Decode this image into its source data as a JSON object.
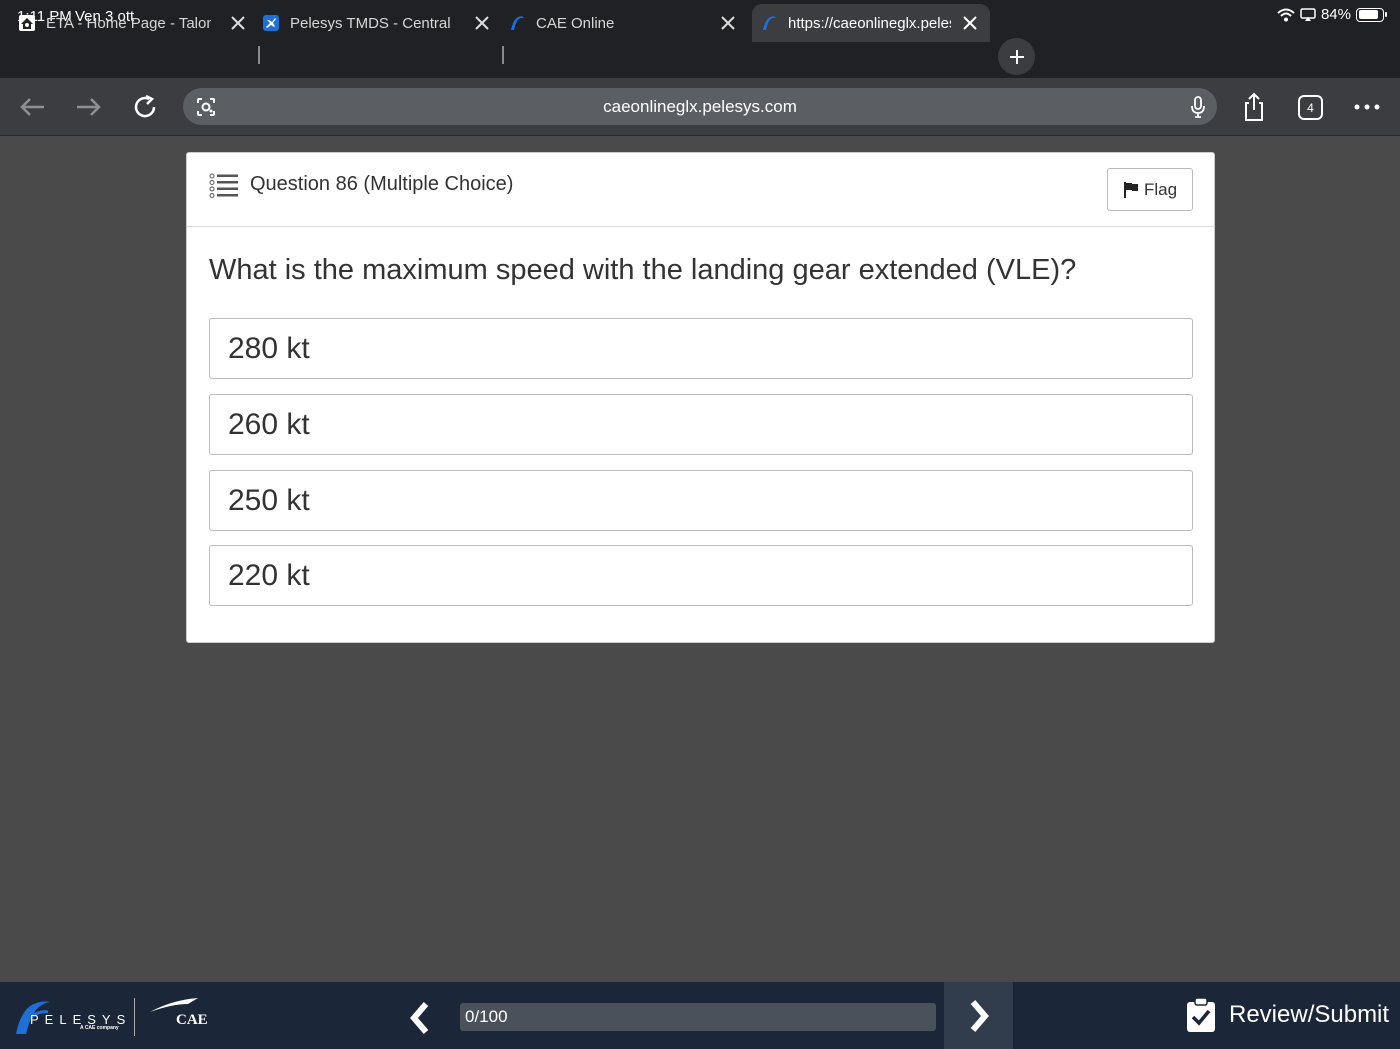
{
  "status_bar": {
    "time": "1:11 PM",
    "date": "Ven 3 ott",
    "battery": "84%",
    "battery_level": 0.84
  },
  "tabs": [
    {
      "title": "ETA - Home Page - Talon",
      "favicon": "home-icon",
      "active": false
    },
    {
      "title": "Pelesys TMDS - Central",
      "favicon": "plane-icon",
      "active": false
    },
    {
      "title": "CAE Online",
      "favicon": "pelesys-icon",
      "active": false
    },
    {
      "title": "https://caeonlineglx.pelesys.com",
      "favicon": "pelesys-icon",
      "active": true
    }
  ],
  "toolbar": {
    "url": "caeonlineglx.pelesys.com",
    "tab_count": "4"
  },
  "question": {
    "header": "Question 86 (Multiple Choice)",
    "flag_label": "Flag",
    "text": "What is the maximum speed with the landing gear extended (VLE)?",
    "answers": [
      "280 kt",
      "260 kt",
      "250 kt",
      "220 kt"
    ]
  },
  "footer": {
    "brand": "PELESYS",
    "brand_sub": "A CAE company",
    "cae": "CAE",
    "progress_text": "0/100",
    "progress_fraction": 0,
    "review_label": "Review/Submit"
  },
  "colors": {
    "accent": "#1e6fd9",
    "footer_bg": "#1b2738",
    "page_bg": "#4a4a4a"
  }
}
